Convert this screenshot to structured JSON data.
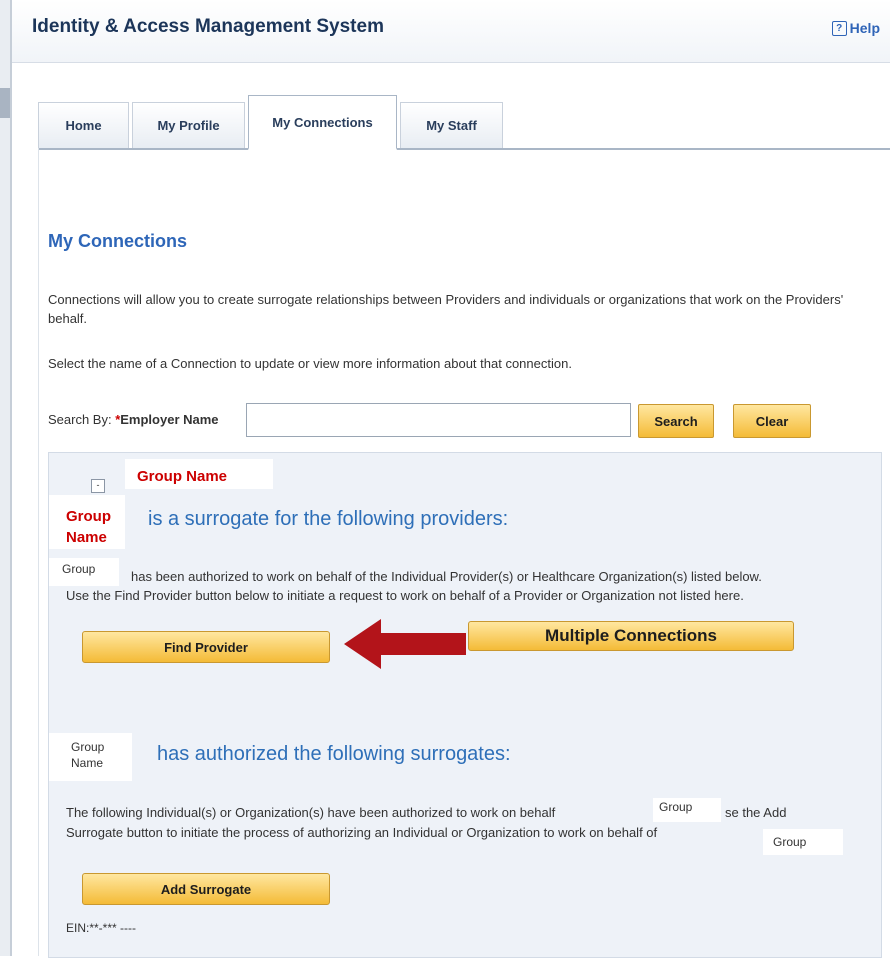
{
  "window": {
    "title": "Identity & Access Management System",
    "help_label": "Help",
    "help_icon": "help-icon"
  },
  "tabs": [
    {
      "label": "Home",
      "active": false
    },
    {
      "label": "My Profile",
      "active": false
    },
    {
      "label": "My Connections",
      "active": true
    },
    {
      "label": "My Staff",
      "active": false
    }
  ],
  "main": {
    "title": "My Connections",
    "intro": "Connections will allow you to create surrogate relationships between Providers and individuals or organizations that work on the Providers' behalf.",
    "instruction": "Select the name of a Connection to update or view more information about that connection.",
    "search": {
      "label_prefix": "Search By: ",
      "required_mark": "*",
      "field_label": "Employer Name",
      "value": "",
      "search_button": "Search",
      "clear_button": "Clear"
    }
  },
  "connection": {
    "group_name_top": "Group Name",
    "group_name_left_1": "Group",
    "group_name_left_2": "Name",
    "surrogate_heading": "is a surrogate for the following providers:",
    "group_small_1": "Group",
    "authorized_text_1": "has been authorized to work on behalf of the Individual Provider(s) or Healthcare Organization(s) listed below.",
    "authorized_text_2": "Use the Find Provider button below to initiate a request to work on behalf of a Provider or Organization not listed here.",
    "find_provider_button": "Find Provider",
    "multiple_connections_button": "Multiple Connections",
    "group_small_2a": "Group",
    "group_small_2b": "Name",
    "authorized_surrogates_heading": "has authorized the following surrogates:",
    "surrogates_text_1a": "The following Individual(s) or Organization(s) have been authorized to work on behalf",
    "group_small_3": "Group",
    "surrogates_text_1b": "se the Add",
    "surrogates_text_2": "Surrogate button to initiate the process of authorizing an Individual or Organization to work on behalf of",
    "group_small_4": "Group",
    "add_surrogate_button": "Add Surrogate",
    "ein_label": "EIN:**-***",
    "ein_value": "----"
  },
  "colors": {
    "accent_blue": "#2e66b8",
    "annotation_red": "#cc0000",
    "button_yellow": "#f4bb37",
    "arrow_red": "#b3141a"
  }
}
